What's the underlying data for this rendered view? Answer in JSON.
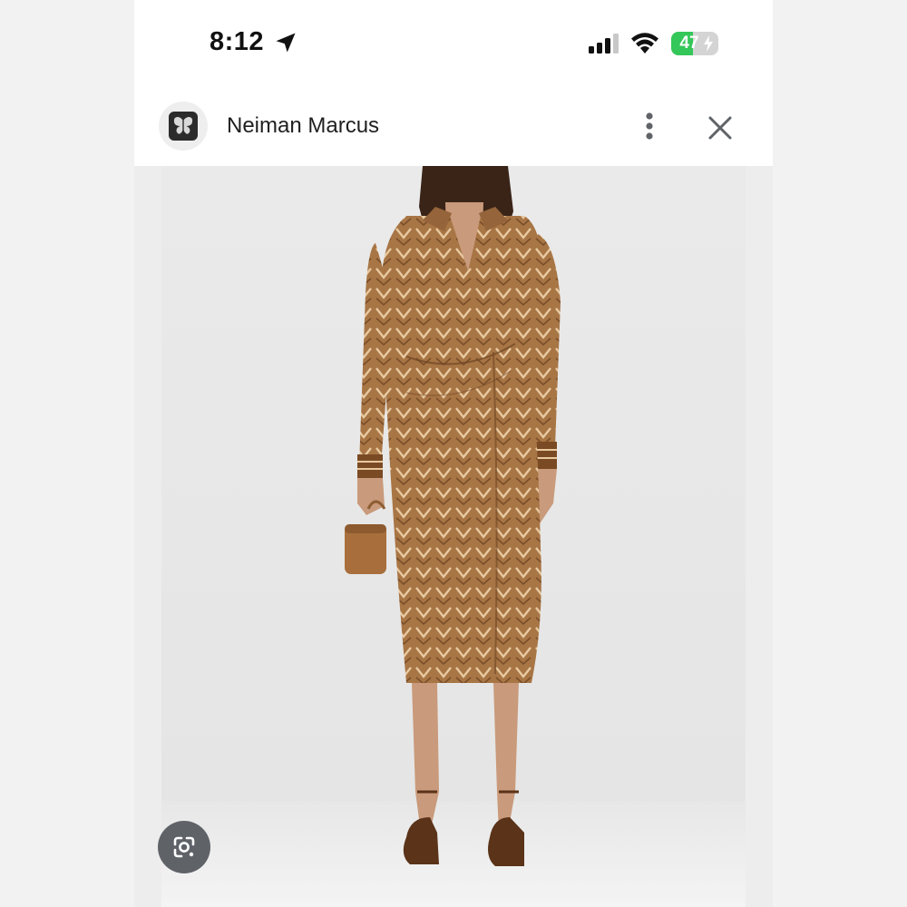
{
  "status_bar": {
    "time": "8:12",
    "location_icon": "location-arrow-icon",
    "signal_icon": "cellular-signal-icon",
    "wifi_icon": "wifi-icon",
    "battery_percent": "47",
    "battery_level": 0.47,
    "battery_charging": true,
    "battery_color": "#34c759"
  },
  "header": {
    "site_logo_icon": "butterfly-icon",
    "site_name": "Neiman Marcus",
    "more_icon": "more-vert-icon",
    "close_icon": "close-icon"
  },
  "content": {
    "image_subject": "product-photo",
    "dress_color": "#a87545",
    "lens_icon": "google-lens-icon"
  }
}
